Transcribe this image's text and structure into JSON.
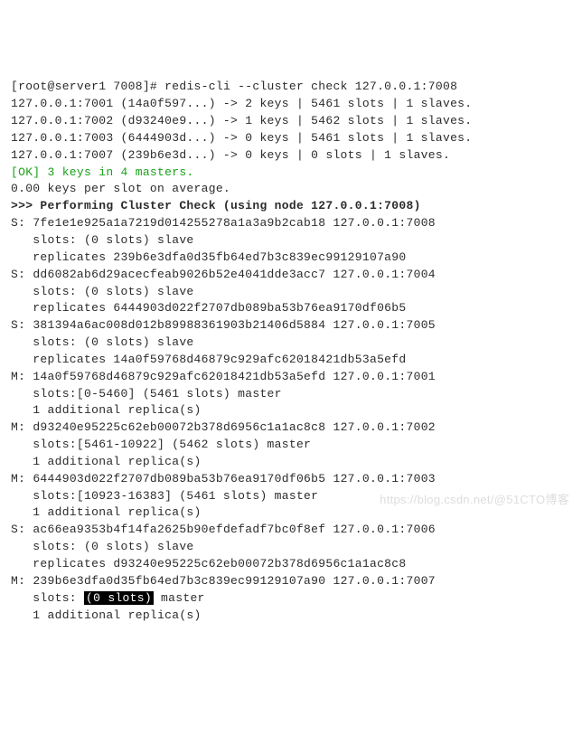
{
  "prompt": {
    "user_host": "[root@server1 7008]#",
    "command": "redis-cli --cluster check 127.0.0.1:7008"
  },
  "summary_lines": [
    "127.0.0.1:7001 (14a0f597...) -> 2 keys | 5461 slots | 1 slaves.",
    "127.0.0.1:7002 (d93240e9...) -> 1 keys | 5462 slots | 1 slaves.",
    "127.0.0.1:7003 (6444903d...) -> 0 keys | 5461 slots | 1 slaves.",
    "127.0.0.1:7007 (239b6e3d...) -> 0 keys | 0 slots | 1 slaves."
  ],
  "ok_line": "[OK] 3 keys in 4 masters.",
  "avg_line": "0.00 keys per slot on average.",
  "header_line": ">>> Performing Cluster Check (using node 127.0.0.1:7008)",
  "nodes": [
    {
      "role": "S:",
      "id": "7fe1e1e925a1a7219d014255278a1a3a9b2cab18",
      "addr": "127.0.0.1:7008",
      "l2": "   slots: (0 slots) slave",
      "l3": "   replicates 239b6e3dfa0d35fb64ed7b3c839ec99129107a90"
    },
    {
      "role": "S:",
      "id": "dd6082ab6d29acecfeab9026b52e4041dde3acc7",
      "addr": "127.0.0.1:7004",
      "l2": "   slots: (0 slots) slave",
      "l3": "   replicates 6444903d022f2707db089ba53b76ea9170df06b5"
    },
    {
      "role": "S:",
      "id": "381394a6ac008d012b89988361903b21406d5884",
      "addr": "127.0.0.1:7005",
      "l2": "   slots: (0 slots) slave",
      "l3": "   replicates 14a0f59768d46879c929afc62018421db53a5efd"
    },
    {
      "role": "M:",
      "id": "14a0f59768d46879c929afc62018421db53a5efd",
      "addr": "127.0.0.1:7001",
      "l2": "   slots:[0-5460] (5461 slots) master",
      "l3": "   1 additional replica(s)"
    },
    {
      "role": "M:",
      "id": "d93240e95225c62eb00072b378d6956c1a1ac8c8",
      "addr": "127.0.0.1:7002",
      "l2": "   slots:[5461-10922] (5462 slots) master",
      "l3": "   1 additional replica(s)"
    },
    {
      "role": "M:",
      "id": "6444903d022f2707db089ba53b76ea9170df06b5",
      "addr": "127.0.0.1:7003",
      "l2": "   slots:[10923-16383] (5461 slots) master",
      "l3": "   1 additional replica(s)"
    },
    {
      "role": "S:",
      "id": "ac66ea9353b4f14fa2625b90efdefadf7bc0f8ef",
      "addr": "127.0.0.1:7006",
      "l2": "   slots: (0 slots) slave",
      "l3": "   replicates d93240e95225c62eb00072b378d6956c1a1ac8c8"
    }
  ],
  "last_node": {
    "role": "M:",
    "id": "239b6e3dfa0d35fb64ed7b3c839ec99129107a90",
    "addr": "127.0.0.1:7007",
    "slots_prefix": "   slots: ",
    "slots_highlight": "(0 slots)",
    "slots_suffix": " master",
    "l3": "   1 additional replica(s)"
  },
  "watermark": "https://blog.csdn.net/@51CTO博客"
}
